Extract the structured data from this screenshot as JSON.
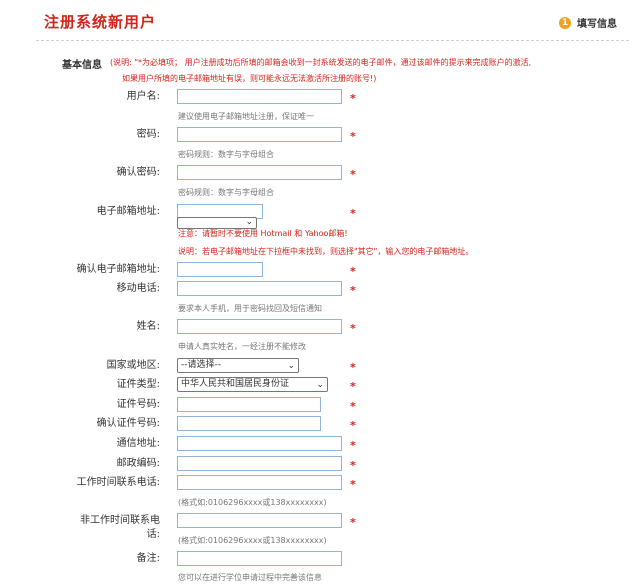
{
  "header": {
    "title": "注册系统新用户",
    "step_number": "1",
    "step_label": "填写信息"
  },
  "section": {
    "title": "基本信息",
    "note_line1": "(说明: \"*为必填项； 用户注册成功后所填的邮箱会收到一封系统发送的电子邮件，通过该邮件的提示来完成账户的激活,",
    "note_line2": "如果用户所填的电子邮箱地址有误，则可能永远无法激活所注册的账号!)"
  },
  "form": {
    "required_mark": "*",
    "username": {
      "label": "用户名:",
      "value": "",
      "hint": "建议使用电子邮箱地址注册，保证唯一"
    },
    "password": {
      "label": "密码:",
      "value": "",
      "hint": "密码规则：数字与字母组合"
    },
    "confirm_password": {
      "label": "确认密码:",
      "value": "",
      "hint": "密码规则：数字与字母组合"
    },
    "email": {
      "label": "电子邮箱地址:",
      "value": "",
      "domain_selected": "",
      "warning": "注意：请暂时不要使用 Hotmail 和 Yahoo邮箱!",
      "instruction": "说明：若电子邮箱地址在下拉框中未找到，则选择\"其它\"，输入您的电子邮箱地址。"
    },
    "confirm_email": {
      "label": "确认电子邮箱地址:",
      "value": ""
    },
    "mobile": {
      "label": "移动电话:",
      "value": "",
      "hint": "要求本人手机，用于密码找回及短信通知"
    },
    "name": {
      "label": "姓名:",
      "value": "",
      "hint": "申请人真实姓名，一经注册不能修改"
    },
    "country": {
      "label": "国家或地区:",
      "selected": "--请选择--"
    },
    "id_type": {
      "label": "证件类型:",
      "selected": "中华人民共和国居民身份证"
    },
    "id_number": {
      "label": "证件号码:",
      "value": ""
    },
    "confirm_id_number": {
      "label": "确认证件号码:",
      "value": ""
    },
    "address": {
      "label": "通信地址:",
      "value": ""
    },
    "postcode": {
      "label": "邮政编码:",
      "value": ""
    },
    "work_phone": {
      "label": "工作时间联系电话:",
      "value": "",
      "hint": "(格式如:0106296xxxx或138xxxxxxxx)"
    },
    "offwork_phone": {
      "label_line1": "非工作时间联系电",
      "label_line2": "话:",
      "value": "",
      "hint": "(格式如:0106296xxxx或138xxxxxxxx)"
    },
    "remark": {
      "label": "备注:",
      "value": "",
      "hint": "您可以在进行学位申请过程中完善该信息"
    }
  },
  "colors": {
    "accent": "#d4241c",
    "badge": "#f0a020",
    "input_border": "#8fb3d9"
  }
}
